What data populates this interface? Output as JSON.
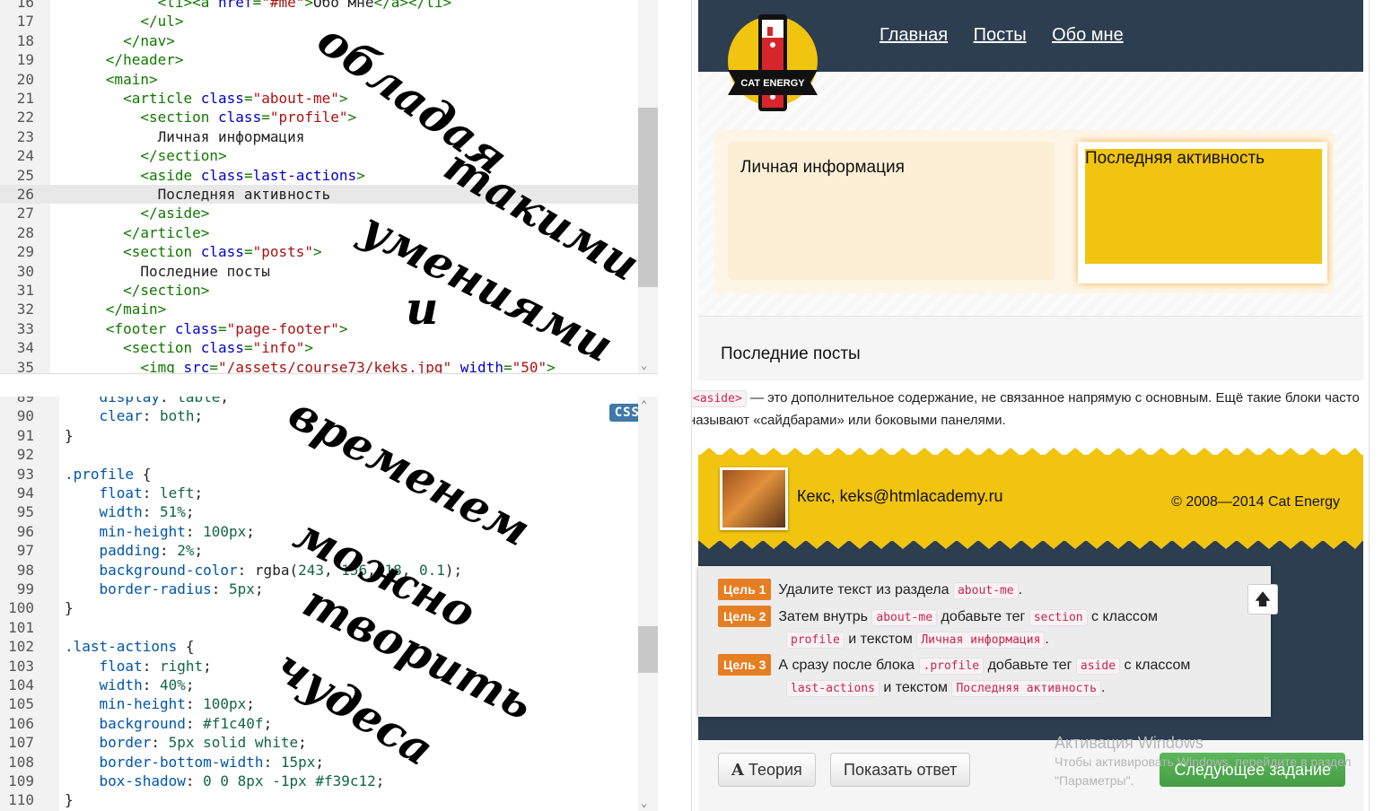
{
  "html_editor": {
    "lines": [
      {
        "n": "16",
        "indent": "            ",
        "parts": [
          [
            "tag",
            "<li><a "
          ],
          [
            "attr",
            "href"
          ],
          [
            "tag",
            "="
          ],
          [
            "str",
            "\"#me\""
          ],
          [
            "tag",
            ">"
          ],
          [
            "txt",
            "Обо мне"
          ],
          [
            "tag",
            "</a></li>"
          ]
        ]
      },
      {
        "n": "17",
        "indent": "          ",
        "parts": [
          [
            "tag",
            "</ul>"
          ]
        ]
      },
      {
        "n": "18",
        "indent": "        ",
        "parts": [
          [
            "tag",
            "</nav>"
          ]
        ]
      },
      {
        "n": "19",
        "indent": "      ",
        "parts": [
          [
            "tag",
            "</header>"
          ]
        ]
      },
      {
        "n": "20",
        "indent": "      ",
        "parts": [
          [
            "tag",
            "<main>"
          ]
        ]
      },
      {
        "n": "21",
        "indent": "        ",
        "parts": [
          [
            "tag",
            "<article "
          ],
          [
            "attr",
            "class"
          ],
          [
            "tag",
            "="
          ],
          [
            "str",
            "\"about-me\""
          ],
          [
            "tag",
            ">"
          ]
        ]
      },
      {
        "n": "22",
        "indent": "          ",
        "parts": [
          [
            "tag",
            "<section "
          ],
          [
            "attr",
            "class"
          ],
          [
            "tag",
            "="
          ],
          [
            "str",
            "\"profile\""
          ],
          [
            "tag",
            ">"
          ]
        ]
      },
      {
        "n": "23",
        "indent": "            ",
        "parts": [
          [
            "txt",
            "Личная информация"
          ]
        ]
      },
      {
        "n": "24",
        "indent": "          ",
        "parts": [
          [
            "tag",
            "</section>"
          ]
        ]
      },
      {
        "n": "25",
        "indent": "          ",
        "parts": [
          [
            "tag",
            "<aside "
          ],
          [
            "attr",
            "class"
          ],
          [
            "tag",
            "="
          ],
          [
            "attr",
            "last-actions"
          ],
          [
            "tag",
            ">"
          ]
        ]
      },
      {
        "n": "26",
        "indent": "            ",
        "parts": [
          [
            "txt",
            "Последняя активность"
          ]
        ]
      },
      {
        "n": "27",
        "indent": "          ",
        "parts": [
          [
            "tag",
            "</aside>"
          ]
        ]
      },
      {
        "n": "28",
        "indent": "        ",
        "parts": [
          [
            "tag",
            "</article>"
          ]
        ]
      },
      {
        "n": "29",
        "indent": "        ",
        "parts": [
          [
            "tag",
            "<section "
          ],
          [
            "attr",
            "class"
          ],
          [
            "tag",
            "="
          ],
          [
            "str",
            "\"posts\""
          ],
          [
            "tag",
            ">"
          ]
        ]
      },
      {
        "n": "30",
        "indent": "          ",
        "parts": [
          [
            "txt",
            "Последние посты"
          ]
        ]
      },
      {
        "n": "31",
        "indent": "        ",
        "parts": [
          [
            "tag",
            "</section>"
          ]
        ]
      },
      {
        "n": "32",
        "indent": "      ",
        "parts": [
          [
            "tag",
            "</main>"
          ]
        ]
      },
      {
        "n": "33",
        "indent": "      ",
        "parts": [
          [
            "tag",
            "<footer "
          ],
          [
            "attr",
            "class"
          ],
          [
            "tag",
            "="
          ],
          [
            "str",
            "\"page-footer\""
          ],
          [
            "tag",
            ">"
          ]
        ]
      },
      {
        "n": "34",
        "indent": "        ",
        "parts": [
          [
            "tag",
            "<section "
          ],
          [
            "attr",
            "class"
          ],
          [
            "tag",
            "="
          ],
          [
            "str",
            "\"info\""
          ],
          [
            "tag",
            ">"
          ]
        ]
      },
      {
        "n": "35",
        "indent": "          ",
        "parts": [
          [
            "tag",
            "<img "
          ],
          [
            "attr",
            "src"
          ],
          [
            "tag",
            "="
          ],
          [
            "str",
            "\"/assets/course73/keks.jpg\""
          ],
          [
            "tag",
            " "
          ],
          [
            "attr",
            "width"
          ],
          [
            "tag",
            "="
          ],
          [
            "str",
            "\"50\""
          ],
          [
            "tag",
            ">"
          ]
        ]
      }
    ],
    "active_line": "26"
  },
  "css_editor": {
    "badge": "CSS",
    "lines": [
      {
        "n": "89",
        "indent": "    ",
        "parts": [
          [
            "prop",
            "display"
          ],
          [
            "txt",
            ": "
          ],
          [
            "val",
            "table"
          ],
          [
            "txt",
            ";"
          ]
        ]
      },
      {
        "n": "90",
        "indent": "    ",
        "parts": [
          [
            "prop",
            "clear"
          ],
          [
            "txt",
            ": "
          ],
          [
            "val",
            "both"
          ],
          [
            "txt",
            ";"
          ]
        ]
      },
      {
        "n": "91",
        "indent": "",
        "parts": [
          [
            "txt",
            "}"
          ]
        ]
      },
      {
        "n": "92",
        "indent": "",
        "parts": [
          [
            "txt",
            ""
          ]
        ]
      },
      {
        "n": "93",
        "indent": "",
        "parts": [
          [
            "sel",
            ".profile"
          ],
          [
            "txt",
            " {"
          ]
        ]
      },
      {
        "n": "94",
        "indent": "    ",
        "parts": [
          [
            "prop",
            "float"
          ],
          [
            "txt",
            ": "
          ],
          [
            "val",
            "left"
          ],
          [
            "txt",
            ";"
          ]
        ]
      },
      {
        "n": "95",
        "indent": "    ",
        "parts": [
          [
            "prop",
            "width"
          ],
          [
            "txt",
            ": "
          ],
          [
            "val",
            "51%"
          ],
          [
            "txt",
            ";"
          ]
        ]
      },
      {
        "n": "96",
        "indent": "    ",
        "parts": [
          [
            "prop",
            "min-height"
          ],
          [
            "txt",
            ": "
          ],
          [
            "val",
            "100px"
          ],
          [
            "txt",
            ";"
          ]
        ]
      },
      {
        "n": "97",
        "indent": "    ",
        "parts": [
          [
            "prop",
            "padding"
          ],
          [
            "txt",
            ": "
          ],
          [
            "val",
            "2%"
          ],
          [
            "txt",
            ";"
          ]
        ]
      },
      {
        "n": "98",
        "indent": "    ",
        "parts": [
          [
            "prop",
            "background-color"
          ],
          [
            "txt",
            ": rgba("
          ],
          [
            "val",
            "243"
          ],
          [
            "txt",
            ", "
          ],
          [
            "val",
            "156"
          ],
          [
            "txt",
            ", "
          ],
          [
            "val",
            "18"
          ],
          [
            "txt",
            ", "
          ],
          [
            "val",
            "0.1"
          ],
          [
            "txt",
            ");"
          ]
        ]
      },
      {
        "n": "99",
        "indent": "    ",
        "parts": [
          [
            "prop",
            "border-radius"
          ],
          [
            "txt",
            ": "
          ],
          [
            "val",
            "5px"
          ],
          [
            "txt",
            ";"
          ]
        ]
      },
      {
        "n": "100",
        "indent": "",
        "parts": [
          [
            "txt",
            "}"
          ]
        ]
      },
      {
        "n": "101",
        "indent": "",
        "parts": [
          [
            "txt",
            ""
          ]
        ]
      },
      {
        "n": "102",
        "indent": "",
        "parts": [
          [
            "sel",
            ".last-actions"
          ],
          [
            "txt",
            " {"
          ]
        ]
      },
      {
        "n": "103",
        "indent": "    ",
        "parts": [
          [
            "prop",
            "float"
          ],
          [
            "txt",
            ": "
          ],
          [
            "val",
            "right"
          ],
          [
            "txt",
            ";"
          ]
        ]
      },
      {
        "n": "104",
        "indent": "    ",
        "parts": [
          [
            "prop",
            "width"
          ],
          [
            "txt",
            ": "
          ],
          [
            "val",
            "40%"
          ],
          [
            "txt",
            ";"
          ]
        ]
      },
      {
        "n": "105",
        "indent": "    ",
        "parts": [
          [
            "prop",
            "min-height"
          ],
          [
            "txt",
            ": "
          ],
          [
            "val",
            "100px"
          ],
          [
            "txt",
            ";"
          ]
        ]
      },
      {
        "n": "106",
        "indent": "    ",
        "parts": [
          [
            "prop",
            "background"
          ],
          [
            "txt",
            ": "
          ],
          [
            "val",
            "#f1c40f"
          ],
          [
            "txt",
            ";"
          ]
        ]
      },
      {
        "n": "107",
        "indent": "    ",
        "parts": [
          [
            "prop",
            "border"
          ],
          [
            "txt",
            ": "
          ],
          [
            "val",
            "5px solid white"
          ],
          [
            "txt",
            ";"
          ]
        ]
      },
      {
        "n": "108",
        "indent": "    ",
        "parts": [
          [
            "prop",
            "border-bottom-width"
          ],
          [
            "txt",
            ": "
          ],
          [
            "val",
            "15px"
          ],
          [
            "txt",
            ";"
          ]
        ]
      },
      {
        "n": "109",
        "indent": "    ",
        "parts": [
          [
            "prop",
            "box-shadow"
          ],
          [
            "txt",
            ": "
          ],
          [
            "val",
            "0 0 8px -1px #f39c12"
          ],
          [
            "txt",
            ";"
          ]
        ]
      },
      {
        "n": "110",
        "indent": "",
        "parts": [
          [
            "txt",
            "}"
          ]
        ]
      }
    ]
  },
  "handwriting": {
    "line1": "обладая",
    "line2": "такими",
    "line3": "умениями",
    "line4": "и",
    "line5": "временем",
    "line6": "можно",
    "line7": "творить",
    "line8": "чудеса"
  },
  "preview": {
    "logo_text": "CAT ENERGY",
    "nav": [
      "Главная",
      "Посты",
      "Обо мне"
    ],
    "profile_text": "Личная информация",
    "last_actions_text": "Последняя активность",
    "posts_text": "Последние посты",
    "tip": {
      "tag": "<aside>",
      "text": " — это дополнительное содержание, не связанное напрямую с основным. Ещё такие блоки часто называют «сайдбарами» или боковыми панелями."
    },
    "footer_name": "Кекс, keks@htmlacademy.ru",
    "footer_copy": "© 2008—2014 Cat Energy",
    "goals": [
      {
        "badge": "Цель 1",
        "parts": [
          [
            "t",
            "Удалите текст из раздела "
          ],
          [
            "c",
            "about-me"
          ],
          [
            "t",
            "."
          ]
        ]
      },
      {
        "badge": "Цель 2",
        "parts": [
          [
            "t",
            "Затем внутрь "
          ],
          [
            "c",
            "about-me"
          ],
          [
            "t",
            " добавьте тег "
          ],
          [
            "c",
            "section"
          ],
          [
            "t",
            " с классом"
          ],
          [
            "br",
            ""
          ],
          [
            "c",
            "profile"
          ],
          [
            "t",
            " и текстом "
          ],
          [
            "c",
            "Личная информация"
          ],
          [
            "t",
            "."
          ]
        ]
      },
      {
        "badge": "Цель 3",
        "parts": [
          [
            "t",
            "А сразу после блока "
          ],
          [
            "c",
            ".profile"
          ],
          [
            "t",
            " добавьте тег "
          ],
          [
            "c",
            "aside"
          ],
          [
            "t",
            " с классом"
          ],
          [
            "br",
            ""
          ],
          [
            "c",
            "last-actions"
          ],
          [
            "t",
            " и текстом "
          ],
          [
            "c",
            "Последняя активность"
          ],
          [
            "t",
            "."
          ]
        ]
      }
    ],
    "up_icon": "arrow-up-icon",
    "buttons": {
      "theory": "Теория",
      "show_answer": "Показать ответ",
      "next": "Следующее задание"
    },
    "watermark": {
      "title": "Активация Windows",
      "line1": "Чтобы активировать Windows, перейдите в раздел",
      "line2": "\"Параметры\"."
    },
    "colors": {
      "header": "#2c3e50",
      "footer": "#f1c40f",
      "goal_badge": "#e67e22",
      "next_button": "#5cb85c"
    }
  }
}
